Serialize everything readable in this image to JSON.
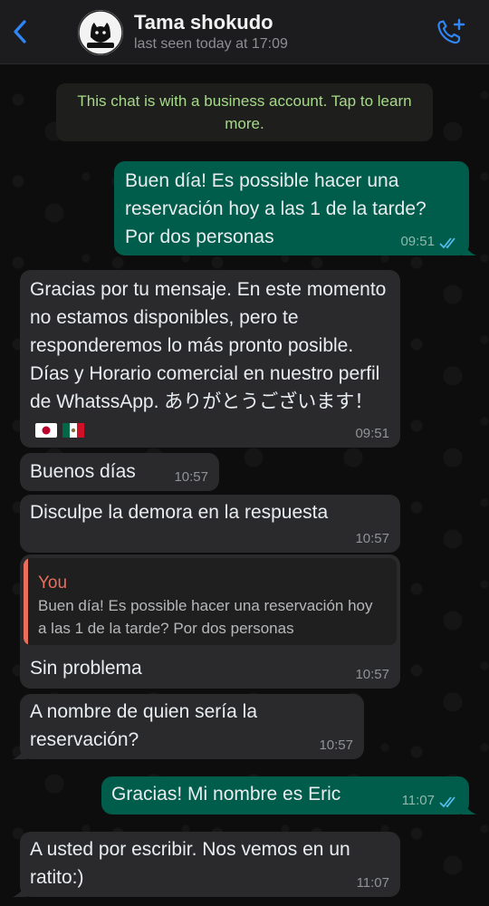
{
  "header": {
    "title": "Tama shokudo",
    "status": "last seen today at 17:09",
    "avatar_text": "TAMA SHOKUDO",
    "back_icon": "chevron-left-icon",
    "call_icon": "phone-plus-icon"
  },
  "notice": {
    "text": "This chat is with a business account. Tap to learn more."
  },
  "colors": {
    "outgoing_bubble": "#005c4b",
    "incoming_bubble": "#2a2a2c",
    "notice_text": "#a7d98a",
    "quote_accent": "#e86f5c",
    "read_ticks": "#53bdeb"
  },
  "messages": [
    {
      "direction": "outgoing",
      "text": "Buen día! Es possible hacer una reservación hoy a las 1 de la tarde? Por dos personas",
      "time": "09:51",
      "read": true
    },
    {
      "direction": "incoming",
      "text": "Gracias por tu mensaje. En este momento no estamos disponibles, pero te responderemos lo más pronto posible. Días y Horario comercial en nuestro perfil de WhatssApp. ありがとうございます！",
      "emoji": [
        "flag-japan-icon",
        "flag-mexico-icon"
      ],
      "time": "09:51"
    },
    {
      "direction": "incoming",
      "text": "Buenos días",
      "time": "10:57"
    },
    {
      "direction": "incoming",
      "text": "Disculpe la demora en la respuesta",
      "time": "10:57"
    },
    {
      "direction": "incoming",
      "quote": {
        "author": "You",
        "text": "Buen día! Es possible hacer una reservación hoy a las 1 de la tarde? Por dos personas"
      },
      "text": "Sin problema",
      "time": "10:57"
    },
    {
      "direction": "incoming",
      "text": "A nombre de quien sería la reservación?",
      "time": "10:57"
    },
    {
      "direction": "outgoing",
      "text": "Gracias! Mi nombre es Eric",
      "time": "11:07",
      "read": true
    },
    {
      "direction": "incoming",
      "text": "A usted por escribir. Nos vemos en un ratito:)",
      "time": "11:07"
    }
  ]
}
